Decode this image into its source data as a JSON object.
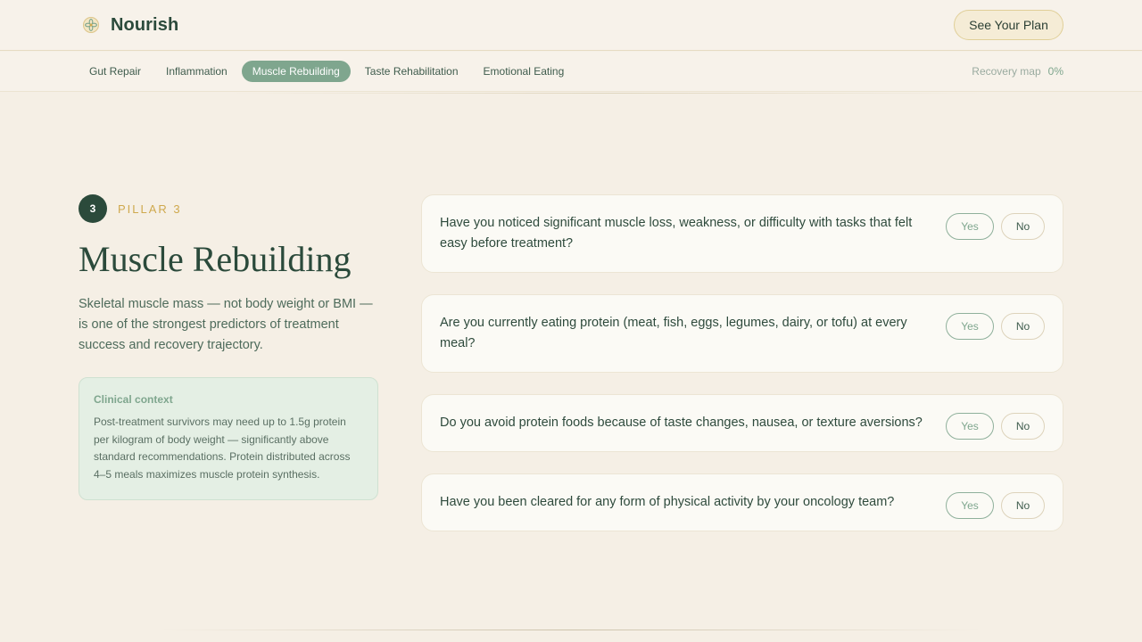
{
  "header": {
    "brand": "Nourish",
    "logo_icon": "flower-icon",
    "cta_label": "See Your Plan"
  },
  "nav": {
    "tabs": [
      {
        "label": "Gut Repair",
        "active": false
      },
      {
        "label": "Inflammation",
        "active": false
      },
      {
        "label": "Muscle Rebuilding",
        "active": true
      },
      {
        "label": "Taste Rehabilitation",
        "active": false
      },
      {
        "label": "Emotional Eating",
        "active": false
      }
    ],
    "recovery_label": "Recovery map",
    "recovery_value": "0%"
  },
  "pillar": {
    "number": "3",
    "label": "PILLAR 3",
    "title": "Muscle Rebuilding",
    "description": "Skeletal muscle mass — not body weight or BMI — is one of the strongest predictors of treatment success and recovery trajectory.",
    "context": {
      "title": "Clinical context",
      "body": "Post-treatment survivors may need up to 1.5g protein per kilogram of body weight — significantly above standard recommendations. Protein distributed across 4–5 meals maximizes muscle protein synthesis."
    }
  },
  "questions": [
    {
      "text": "Have you noticed significant muscle loss, weakness, or difficulty with tasks that felt easy before treatment?",
      "yes_label": "Yes",
      "no_label": "No"
    },
    {
      "text": "Are you currently eating protein (meat, fish, eggs, legumes, dairy, or tofu) at every meal?",
      "yes_label": "Yes",
      "no_label": "No"
    },
    {
      "text": "Do you avoid protein foods because of taste changes, nausea, or texture aversions?",
      "yes_label": "Yes",
      "no_label": "No"
    },
    {
      "text": "Have you been cleared for any form of physical activity by your oncology team?",
      "yes_label": "Yes",
      "no_label": "No"
    }
  ],
  "colors": {
    "background": "#f5efe5",
    "brand_dark": "#2b4a3b",
    "accent_sage": "#7fa68e",
    "accent_gold": "#cfa94e",
    "context_bg": "#e4efe4"
  }
}
